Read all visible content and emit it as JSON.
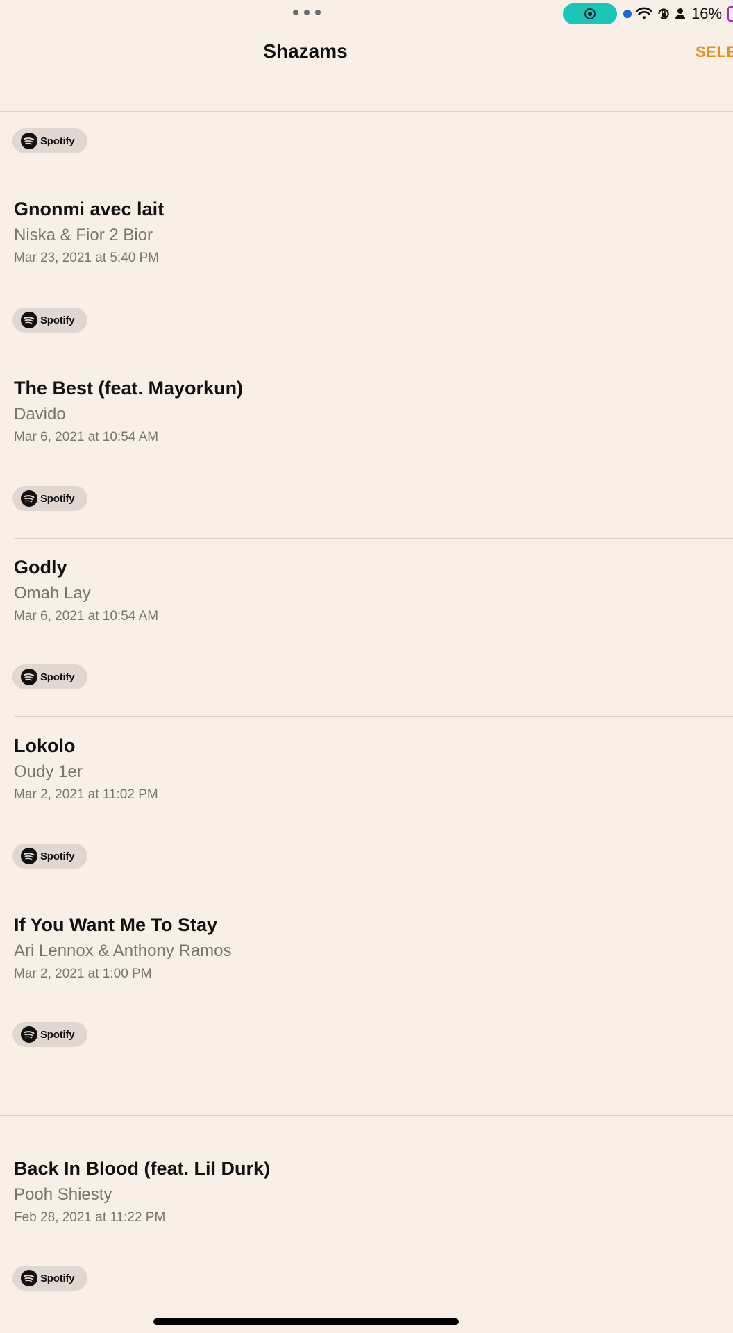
{
  "status_bar": {
    "battery_percent": "16%",
    "colors": {
      "record_pill": "#19C6B7",
      "location_dot": "#1566E0",
      "battery_outline": "#C21DBE"
    }
  },
  "nav": {
    "title": "Shazams",
    "select_label": "SELECT",
    "accent_color": "#E8901A"
  },
  "spotify_label": "Spotify",
  "songs": [
    {
      "title": "Gnonmi avec lait",
      "artist": "Niska & Fior 2 Bior",
      "date": "Mar 23, 2021 at 5:40 PM"
    },
    {
      "title": "The Best (feat. Mayorkun)",
      "artist": "Davido",
      "date": "Mar 6, 2021 at 10:54 AM"
    },
    {
      "title": "Godly",
      "artist": "Omah Lay",
      "date": "Mar 6, 2021 at 10:54 AM"
    },
    {
      "title": "Lokolo",
      "artist": "Oudy 1er",
      "date": "Mar 2, 2021 at 11:02 PM"
    },
    {
      "title": "If You Want Me To Stay",
      "artist": "Ari Lennox & Anthony Ramos",
      "date": "Mar 2, 2021 at 1:00 PM"
    },
    {
      "title": "Back In Blood (feat. Lil Durk)",
      "artist": "Pooh Shiesty",
      "date": "Feb 28, 2021 at 11:22 PM"
    }
  ]
}
